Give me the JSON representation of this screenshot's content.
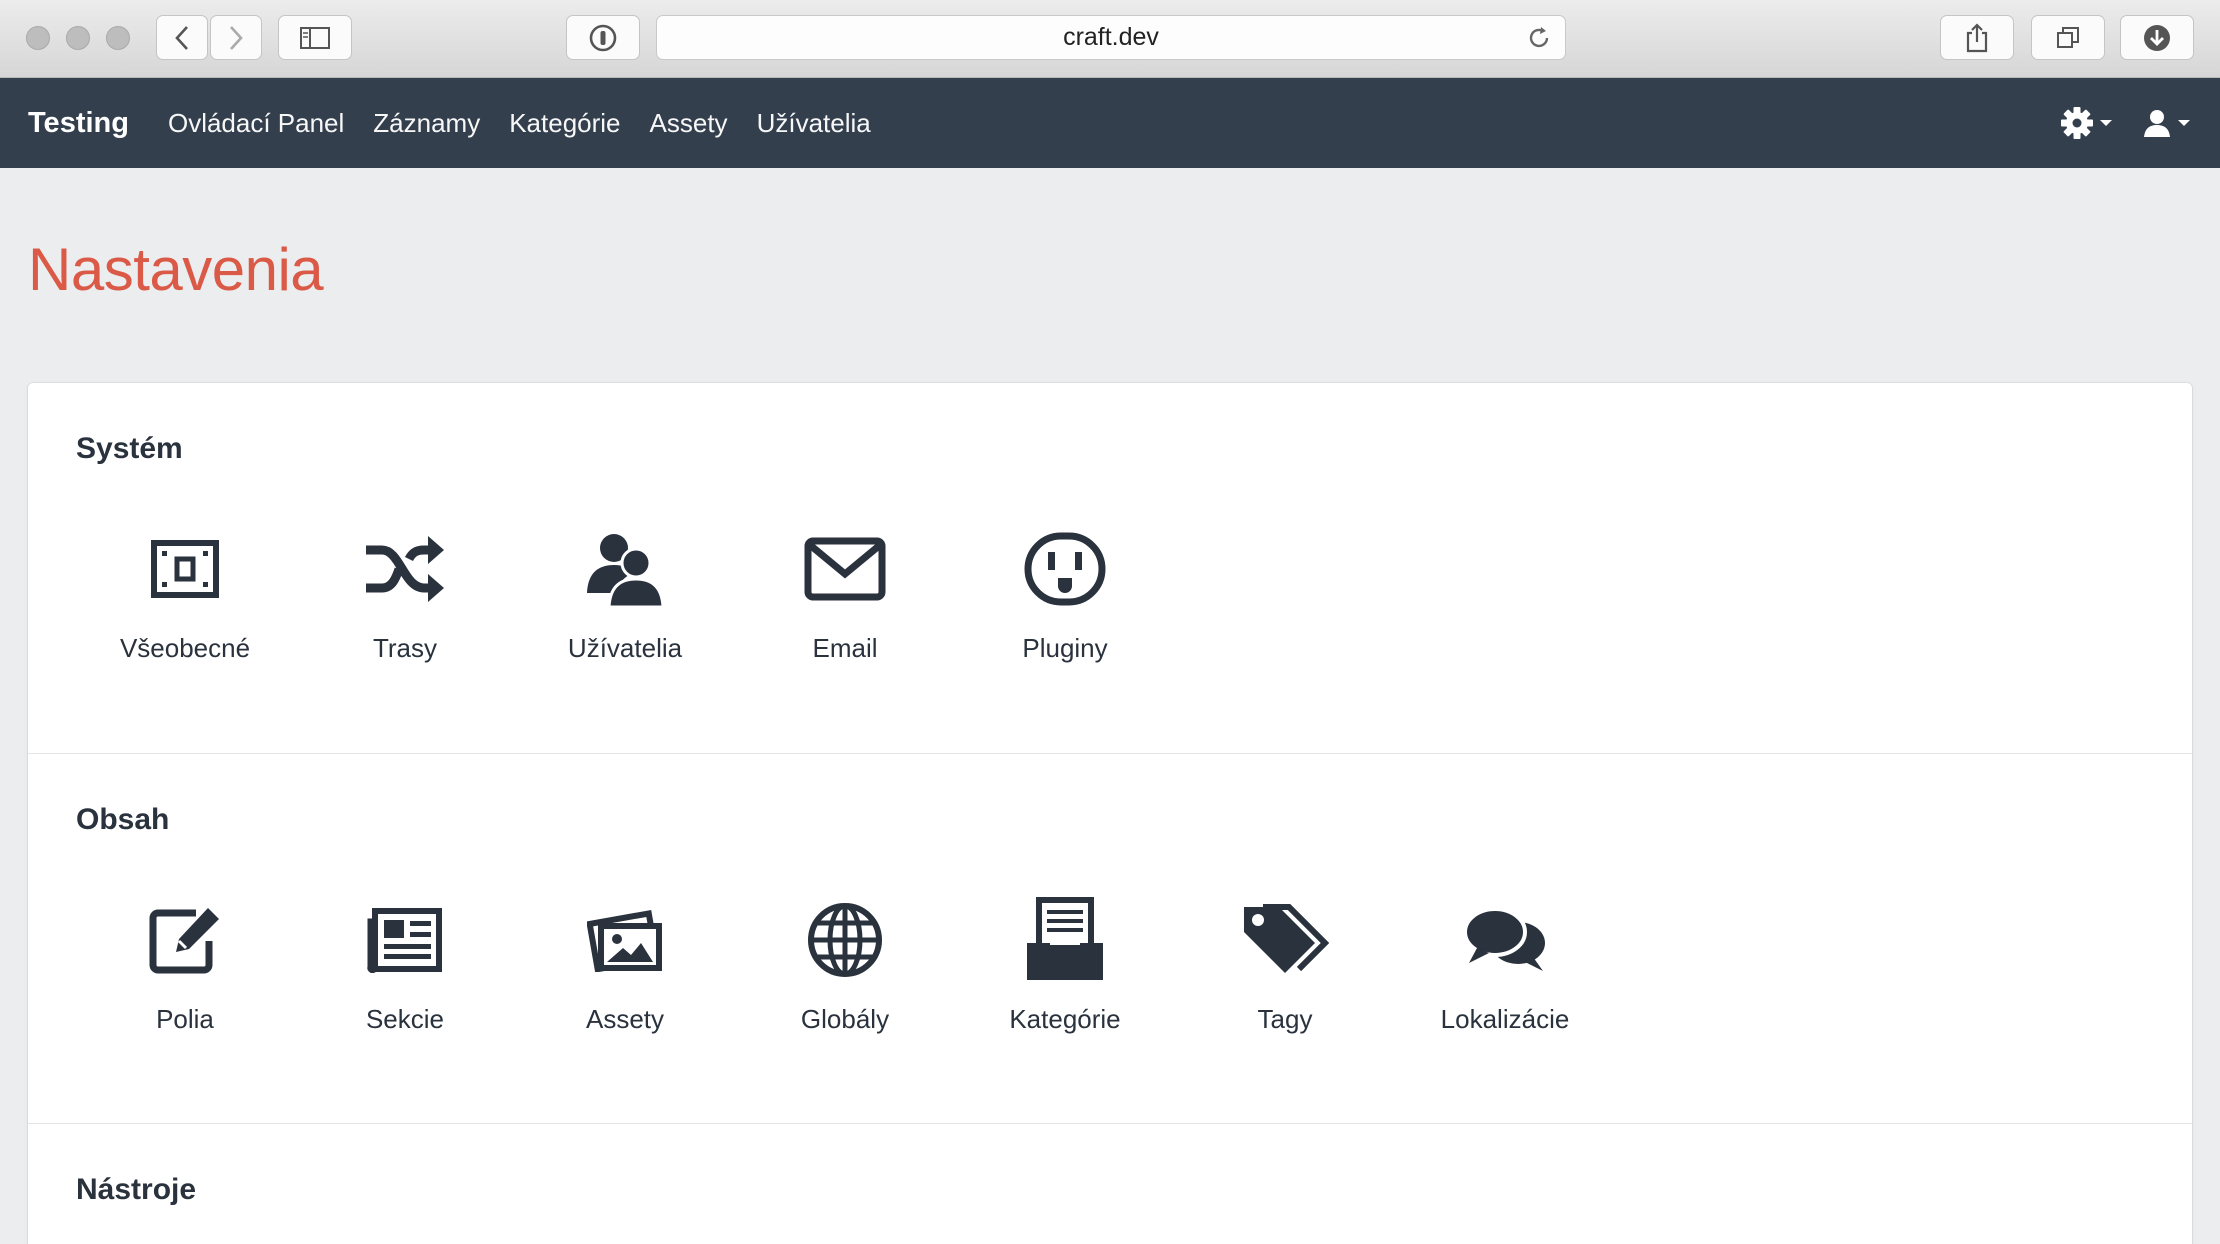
{
  "browser": {
    "url": "craft.dev"
  },
  "nav": {
    "brand": "Testing",
    "links": [
      "Ovládací Panel",
      "Záznamy",
      "Kategórie",
      "Assety",
      "Užívatelia"
    ]
  },
  "page": {
    "title": "Nastavenia"
  },
  "sections": [
    {
      "title": "Systém",
      "items": [
        {
          "label": "Všeobecné",
          "icon": "general-icon"
        },
        {
          "label": "Trasy",
          "icon": "shuffle-icon"
        },
        {
          "label": "Užívatelia",
          "icon": "users-icon"
        },
        {
          "label": "Email",
          "icon": "envelope-icon"
        },
        {
          "label": "Pluginy",
          "icon": "plug-socket-icon"
        }
      ]
    },
    {
      "title": "Obsah",
      "items": [
        {
          "label": "Polia",
          "icon": "edit-icon"
        },
        {
          "label": "Sekcie",
          "icon": "newspaper-icon"
        },
        {
          "label": "Assety",
          "icon": "images-icon"
        },
        {
          "label": "Globály",
          "icon": "globe-icon"
        },
        {
          "label": "Kategórie",
          "icon": "inbox-tray-icon"
        },
        {
          "label": "Tagy",
          "icon": "tags-icon"
        },
        {
          "label": "Lokalizácie",
          "icon": "chat-bubbles-icon"
        }
      ]
    },
    {
      "title": "Nástroje",
      "items": []
    }
  ],
  "colors": {
    "nav_bg": "#333f4d",
    "title_accent": "#da5a47",
    "page_bg": "#ecedef",
    "icon_color": "#29323d"
  }
}
